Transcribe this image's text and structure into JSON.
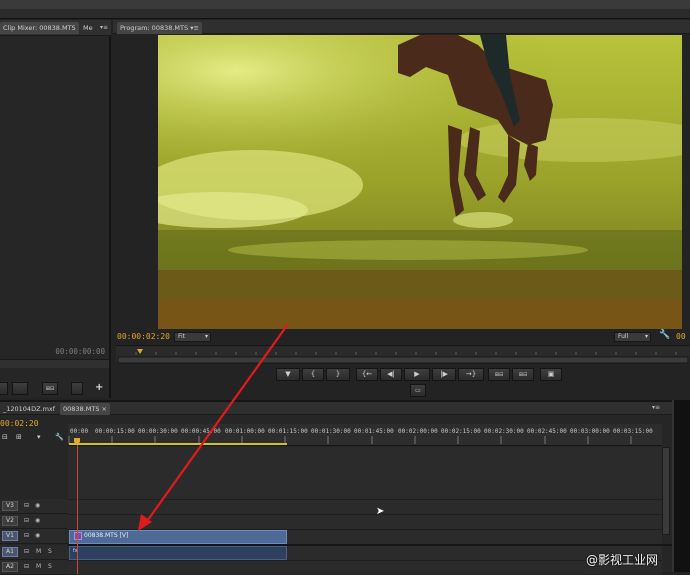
{
  "top_bar": {},
  "source_panel": {
    "tab_label": "Clip Mixer: 00838.MTS",
    "tab2_label": "Me",
    "timecode": "00:00:00:00"
  },
  "program_monitor": {
    "tab_label": "Program: 00838.MTS",
    "current_timecode": "00:00:02:20",
    "zoom_value": "Fit",
    "resolution_value": "Full",
    "duration_partial": "00"
  },
  "transport": {
    "buttons": [
      "marker",
      "in",
      "out",
      "go-to-in",
      "step-back",
      "play",
      "step-forward",
      "go-to-out",
      "insert",
      "overwrite",
      "lift",
      "extract",
      "export-frame"
    ],
    "marker_glyph": "▼",
    "in_glyph": "{",
    "out_glyph": "}",
    "go_in_glyph": "{←",
    "step_back_glyph": "◀|",
    "play_glyph": "▶",
    "step_fwd_glyph": "|▶",
    "go_out_glyph": "→}",
    "export_glyph": "▣"
  },
  "timeline": {
    "tab1_label": "_120104DZ.mxf",
    "tab2_label": "00838.MTS",
    "current_timecode": "00:02:20",
    "ruler_labels": [
      "00:00",
      "00:00:15:00",
      "00:00:30:00",
      "00:00:45:00",
      "00:01:00:00",
      "00:01:15:00",
      "00:01:30:00",
      "00:01:45:00",
      "00:02:00:00",
      "00:02:15:00",
      "00:02:30:00",
      "00:02:45:00",
      "00:03:00:00",
      "00:03:15:00"
    ],
    "tracks": [
      {
        "name": "V3",
        "type": "video"
      },
      {
        "name": "V2",
        "type": "video"
      },
      {
        "name": "V1",
        "type": "video",
        "selected": true
      },
      {
        "name": "A1",
        "type": "audio",
        "selected": true,
        "m": "M",
        "s": "S"
      },
      {
        "name": "A2",
        "type": "audio",
        "m": "M",
        "s": "S"
      }
    ],
    "clip_label": "00838.MTS [V]",
    "audio_clip_badge": "fx"
  },
  "watermark": {
    "text": "@影视工业网"
  },
  "colors": {
    "timecode": "#e3a82e",
    "annotation_arrow": "#e11b1b",
    "clip_video": "#4d6b96",
    "clip_audio": "#2d4060"
  }
}
